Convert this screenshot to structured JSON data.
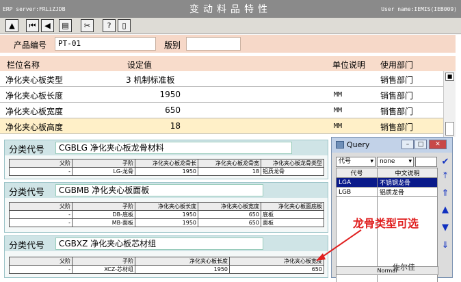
{
  "window": {
    "server": "ERP server:FRLiZJDB",
    "title": "变动料品特性",
    "user": "User name:IEMIS(IEB009)"
  },
  "toolbar": {
    "buttons": [
      {
        "name": "up-icon",
        "glyph": "▲"
      },
      {
        "name": "first-record-icon",
        "glyph": "⏮"
      },
      {
        "name": "previous-record-icon",
        "glyph": "◀"
      },
      {
        "name": "print-icon",
        "glyph": "▤"
      },
      {
        "name": "delete-icon",
        "glyph": "✂"
      },
      {
        "name": "help-icon",
        "glyph": "?"
      },
      {
        "name": "exit-icon",
        "glyph": "▯"
      }
    ]
  },
  "product": {
    "code_label": "产品编号",
    "code_value": "PT-01",
    "version_label": "版别",
    "version_value": ""
  },
  "columns": {
    "field_name": "栏位名称",
    "value": "设定值",
    "unit": "单位说明",
    "dept": "使用部门"
  },
  "props": [
    {
      "name": "净化夹心板类型",
      "value": "3 机制标准板",
      "unit": "",
      "dept": "销售部门"
    },
    {
      "name": "净化夹心板长度",
      "value": "1950",
      "unit": "MM",
      "dept": "销售部门"
    },
    {
      "name": "净化夹心板宽度",
      "value": "650",
      "unit": "MM",
      "dept": "销售部门"
    },
    {
      "name": "净化夹心板高度",
      "value": "18",
      "unit": "MM",
      "dept": "销售部门"
    }
  ],
  "sections": [
    {
      "label": "分类代号",
      "value": "CGBLG 净化夹心板龙骨材料",
      "headers": [
        "父阶",
        "子阶",
        "净化夹心板龙骨长",
        "净化夹心板龙骨宽",
        "净化夹心板龙骨类型"
      ],
      "rows": [
        [
          "-",
          "LG-龙骨",
          "1950",
          "18",
          "铝质龙骨"
        ]
      ]
    },
    {
      "label": "分类代号",
      "value": "CGBMB 净化夹心板面板",
      "headers": [
        "父阶",
        "子阶",
        "净化夹心板长度",
        "净化夹心板宽度",
        "净化夹心板面底板"
      ],
      "rows": [
        [
          "-",
          "DB-底板",
          "1950",
          "650",
          "底板"
        ],
        [
          "-",
          "MB-面板",
          "1950",
          "650",
          "面板"
        ]
      ]
    },
    {
      "label": "分类代号",
      "value": "CGBXZ 净化夹心板芯材组",
      "headers": [
        "父阶",
        "子阶",
        "净化夹心板长度",
        "净化夹心板宽度"
      ],
      "rows": [
        [
          "-",
          "XCZ-芯材组",
          "1950",
          "650"
        ]
      ]
    }
  ],
  "query": {
    "title": "Query",
    "filter_field": "代号",
    "filter_op": "none",
    "filter_value": "",
    "headers": [
      "代号",
      "中文说明"
    ],
    "rows": [
      [
        "LGA",
        "不锈钢龙骨"
      ],
      [
        "LGB",
        "铝质龙骨"
      ]
    ],
    "status": "Normal"
  },
  "annotation": "龙骨类型可选",
  "watermark": "佐尔佳",
  "colors": {
    "annotation": "#e02020",
    "selection": "#0a1a8a"
  }
}
